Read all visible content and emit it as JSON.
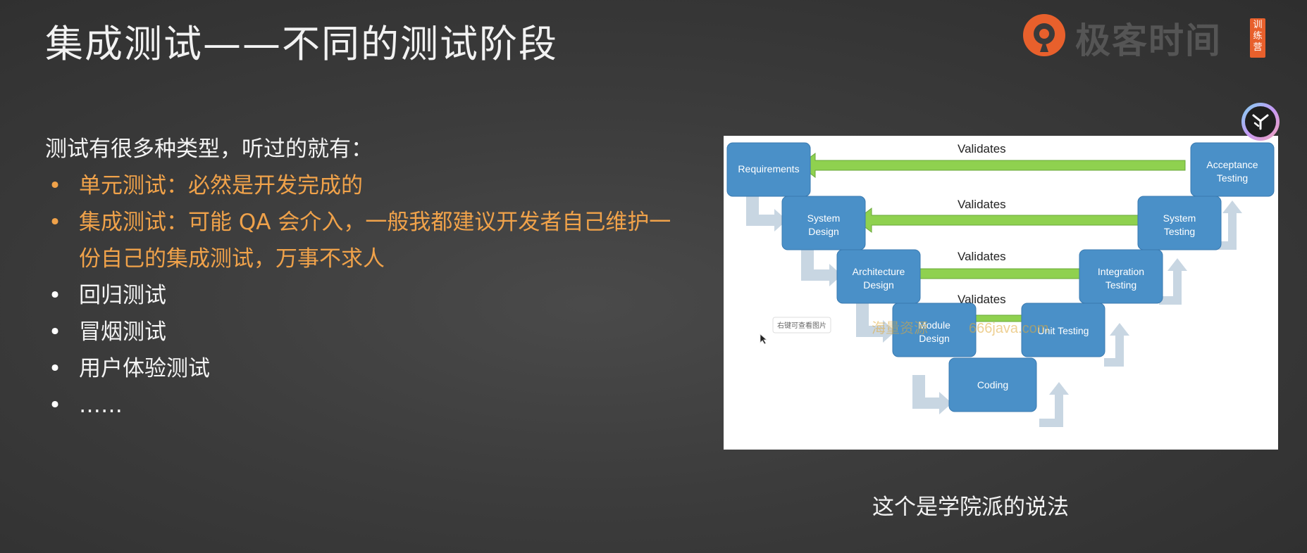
{
  "slide": {
    "title": "集成测试——不同的测试阶段",
    "intro": "测试有很多种类型，听过的就有：",
    "bullets": [
      {
        "text": "单元测试：必然是开发完成的",
        "highlight": true
      },
      {
        "text": "集成测试：可能 QA 会介入，一般我都建议开发者自己维护一份自己的集成测试，万事不求人",
        "highlight": true
      },
      {
        "text": "回归测试",
        "highlight": false
      },
      {
        "text": "冒烟测试",
        "highlight": false
      },
      {
        "text": "用户体验测试",
        "highlight": false
      },
      {
        "text": "……",
        "highlight": false
      }
    ],
    "bullet_symbol": "•",
    "caption": "这个是学院派的说法",
    "colors": {
      "highlight": "#f0a24a",
      "box_blue": "#4a90c8",
      "arrow_green": "#8fd14f",
      "gray_arrow": "#c8d6e2"
    }
  },
  "logo": {
    "brand": "极客时间",
    "tag": "训练营",
    "icon": "geektime-logo-icon"
  },
  "diagram": {
    "validates_label": "Validates",
    "boxes": {
      "requirements": "Requirements",
      "system_design": [
        "System",
        "Design"
      ],
      "architecture_design": [
        "Architecture",
        "Design"
      ],
      "module_design": [
        "Module",
        "Design"
      ],
      "coding": "Coding",
      "unit_testing": "Unit Testing",
      "integration_testing": [
        "Integration",
        "Testing"
      ],
      "system_testing": [
        "System",
        "Testing"
      ],
      "acceptance_testing": [
        "Acceptance",
        "Testing"
      ]
    },
    "tooltip": "右键可查看图片",
    "watermark_left": "海量资源",
    "watermark_right": "666java.com"
  }
}
